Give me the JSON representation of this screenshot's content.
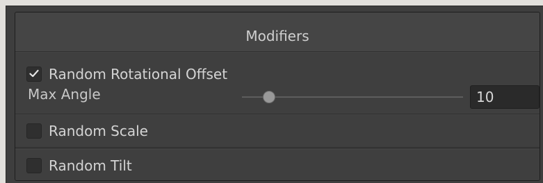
{
  "panel": {
    "title": "Modifiers"
  },
  "rotational_offset": {
    "label": "Random Rotational Offset",
    "checked": true,
    "max_angle": {
      "label": "Max Angle",
      "value": "10",
      "slider_fraction": 0.1
    }
  },
  "random_scale": {
    "label": "Random Scale",
    "checked": false
  },
  "random_tilt": {
    "label": "Random Tilt",
    "checked": false
  },
  "colors": {
    "panel_bg": "#383838",
    "header_bg": "#454545",
    "field_bg": "#2a2a2a",
    "text": "#d2d2d2",
    "checkbox_bg": "#2f2f2f",
    "slider_thumb": "#999999"
  },
  "icons": {
    "checkmark": "check-icon"
  }
}
